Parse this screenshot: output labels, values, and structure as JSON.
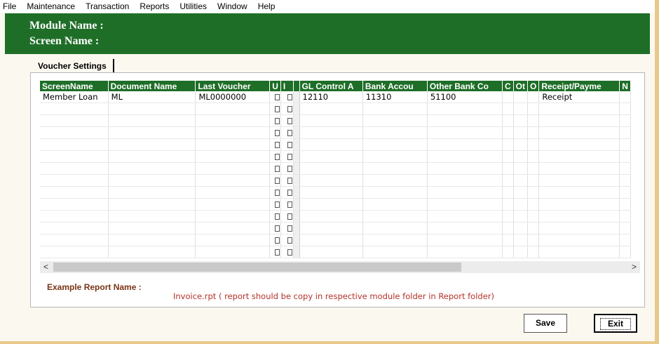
{
  "menu": [
    "File",
    "Maintenance",
    "Transaction",
    "Reports",
    "Utilities",
    "Window",
    "Help"
  ],
  "header": {
    "module_label": "Module Name :",
    "screen_label": "Screen Name :"
  },
  "tab": {
    "label": "Voucher Settings"
  },
  "grid": {
    "columns": [
      "ScreenName",
      "Document Name",
      "Last Voucher",
      "U",
      "I",
      "",
      "GL Control A",
      "Bank Accou",
      "Other Bank Co",
      "C",
      "Ot",
      "O",
      "Receipt/Payme",
      "N"
    ],
    "rows": [
      {
        "screen_name": "Member Loan",
        "document_name": "ML",
        "last_voucher": "ML0000000",
        "gl_control": "12110",
        "bank_account": "11310",
        "other_bank": "51100",
        "receipt_payment": "Receipt"
      }
    ],
    "empty_rows": 13
  },
  "scrollbar": {
    "left_arrow": "<",
    "right_arrow": ">"
  },
  "footer": {
    "example_label": "Example Report Name :",
    "example_value": "Invoice.rpt ( report should be copy in respective module folder in Report folder)"
  },
  "buttons": {
    "save": "Save",
    "exit": "Exit"
  }
}
